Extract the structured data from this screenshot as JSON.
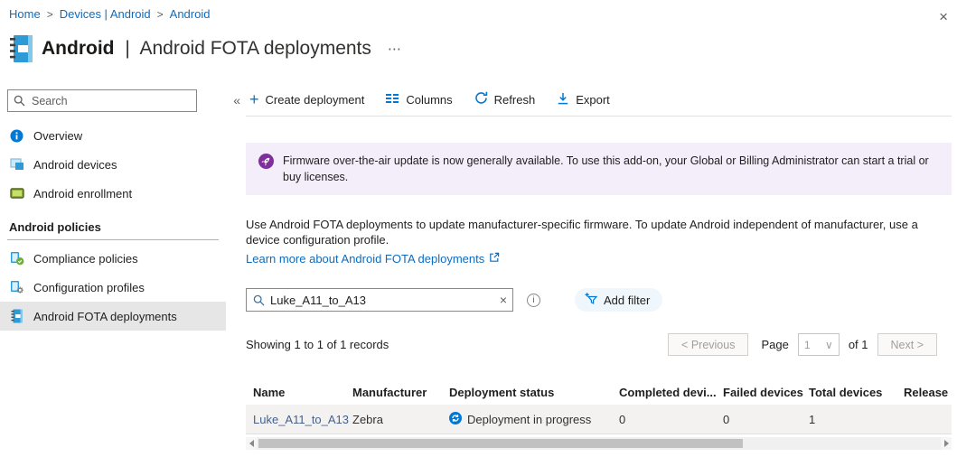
{
  "colors": {
    "accent": "#0078d4",
    "link": "#0f6cbd",
    "banner_bg": "#f4edfa",
    "banner_icon": "#7e2f9b",
    "selected_item_bg": "#e6e6e6",
    "row_bg": "#f3f2f1",
    "status_icon": "#0078d4"
  },
  "icons": {
    "breadcrumb_separator": ">",
    "more": "⋯",
    "close": "×",
    "collapse": "«",
    "clear": "×",
    "info": "i",
    "select_chevron": "∨",
    "plus": "+"
  },
  "breadcrumb": {
    "items": [
      {
        "label": "Home"
      },
      {
        "label": "Devices | Android"
      },
      {
        "label": "Android"
      }
    ]
  },
  "header": {
    "title": "Android",
    "separator": "|",
    "subtitle": "Android FOTA deployments"
  },
  "sidebar": {
    "search_placeholder": "Search",
    "items": [
      {
        "label": "Overview"
      },
      {
        "label": "Android devices"
      },
      {
        "label": "Android enrollment"
      }
    ],
    "section": {
      "title": "Android policies",
      "items": [
        {
          "label": "Compliance policies"
        },
        {
          "label": "Configuration profiles"
        },
        {
          "label": "Android FOTA deployments"
        }
      ]
    }
  },
  "toolbar": {
    "create_label": "Create deployment",
    "columns_label": "Columns",
    "refresh_label": "Refresh",
    "export_label": "Export"
  },
  "banner": {
    "text": "Firmware over-the-air update is now generally available. To use this add-on, your Global or Billing Administrator can start a trial or buy licenses."
  },
  "intro": {
    "text": "Use Android FOTA deployments to update manufacturer-specific firmware. To update Android independent of manufacturer, use a device configuration profile.",
    "link_label": "Learn more about Android FOTA deployments"
  },
  "filter": {
    "search_value": "Luke_A11_to_A13",
    "add_filter_label": "Add filter"
  },
  "pagination": {
    "summary": "Showing 1 to 1 of 1 records",
    "previous_label": "< Previous",
    "page_label": "Page",
    "page_value": "1",
    "of_label": "of 1",
    "next_label": "Next >"
  },
  "table": {
    "headers": [
      "Name",
      "Manufacturer",
      "Deployment status",
      "Completed devi...",
      "Failed devices",
      "Total devices",
      "Release"
    ],
    "rows": [
      {
        "name": "Luke_A11_to_A13",
        "manufacturer": "Zebra",
        "status": "Deployment in progress",
        "completed_devices": "0",
        "failed_devices": "0",
        "total_devices": "1",
        "release": ""
      }
    ]
  }
}
